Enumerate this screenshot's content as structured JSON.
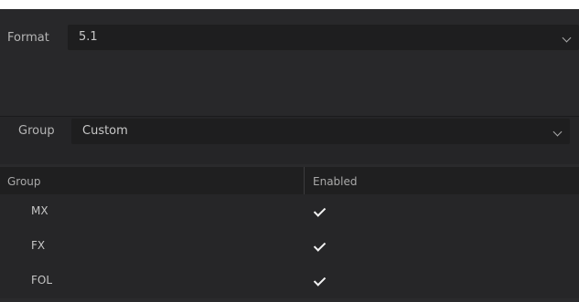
{
  "format": {
    "label": "Format",
    "value": "5.1"
  },
  "group": {
    "label": "Group",
    "value": "Custom"
  },
  "table": {
    "headers": [
      "Group",
      "Enabled"
    ],
    "rows": [
      {
        "name": "MX",
        "enabled": true
      },
      {
        "name": "FX",
        "enabled": true
      },
      {
        "name": "FOL",
        "enabled": true
      }
    ]
  }
}
